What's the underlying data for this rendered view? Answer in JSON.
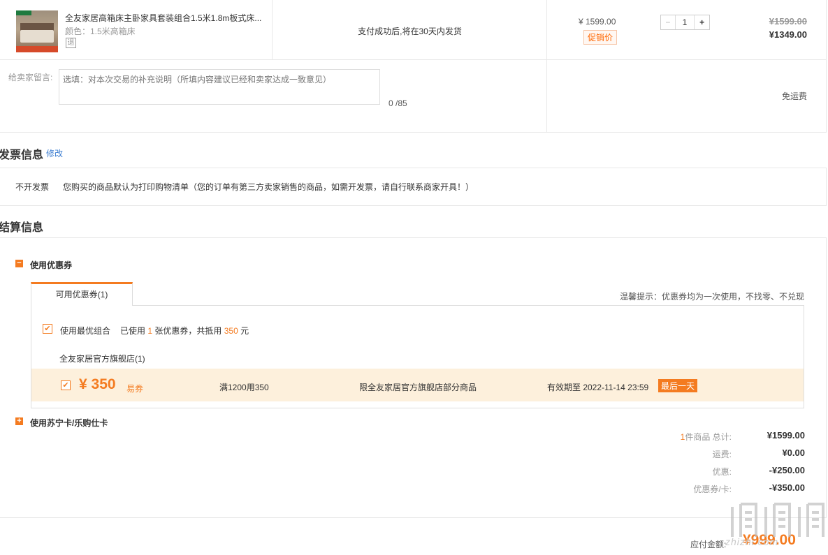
{
  "product": {
    "title": "全友家居高箱床主卧家具套装组合1.5米1.8m板式床...",
    "color_label": "颜色：",
    "color_value": "1.5米高箱床",
    "return_badge": "退",
    "shipping_note": "支付成功后,将在30天内发货",
    "price": "¥ 1599.00",
    "promo_tag": "促销价",
    "qty_minus": "−",
    "quantity": "1",
    "qty_plus": "+",
    "original_total": "¥1599.00",
    "final_total": "¥1349.00"
  },
  "message": {
    "label": "给卖家留言:",
    "placeholder": "选填：对本次交易的补充说明（所填内容建议已经和卖家达成一致意见）",
    "count": "0 /85",
    "shipping_fee": "免运费"
  },
  "invoice": {
    "title": "发票信息",
    "edit": "修改",
    "type": "不开发票",
    "description": "您购买的商品默认为打印购物清单（您的订单有第三方卖家销售的商品，如需开发票，请自行联系商家开具！）"
  },
  "settlement": {
    "title": "结算信息",
    "coupon_toggle_icon": "−",
    "coupon_label": "使用优惠券",
    "tab_available": "可用优惠券(1)",
    "tip": "温馨提示：优惠券均为一次使用，不找零、不兑现",
    "best_combo_label": "使用最优组合",
    "used_prefix": "已使用",
    "used_count": "1",
    "used_middle": "张优惠券，共抵用",
    "used_amount": "350",
    "used_suffix": "元",
    "store_name": "全友家居官方旗舰店(1)",
    "coupon": {
      "checked_icon": "✔",
      "amount": "¥ 350",
      "type": "易券",
      "rule": "满1200用350",
      "scope": "限全友家居官方旗舰店部分商品",
      "validity": "有效期至 2022-11-14 23:59",
      "badge": "最后一天"
    },
    "card_toggle_icon": "+",
    "card_label": "使用苏宁卡/乐购仕卡"
  },
  "summary": {
    "item_count": "1",
    "items_label": "件商品 总计:",
    "items_total": "¥1599.00",
    "shipping_label": "运费:",
    "shipping_value": "¥0.00",
    "discount_label": "优惠:",
    "discount_value": "-¥250.00",
    "coupon_label": "优惠券/卡:",
    "coupon_value": "-¥350.00",
    "payable_label": "应付金额:",
    "payable_value": "¥999.00"
  },
  "watermark": {
    "url": "zhizhi.com"
  }
}
